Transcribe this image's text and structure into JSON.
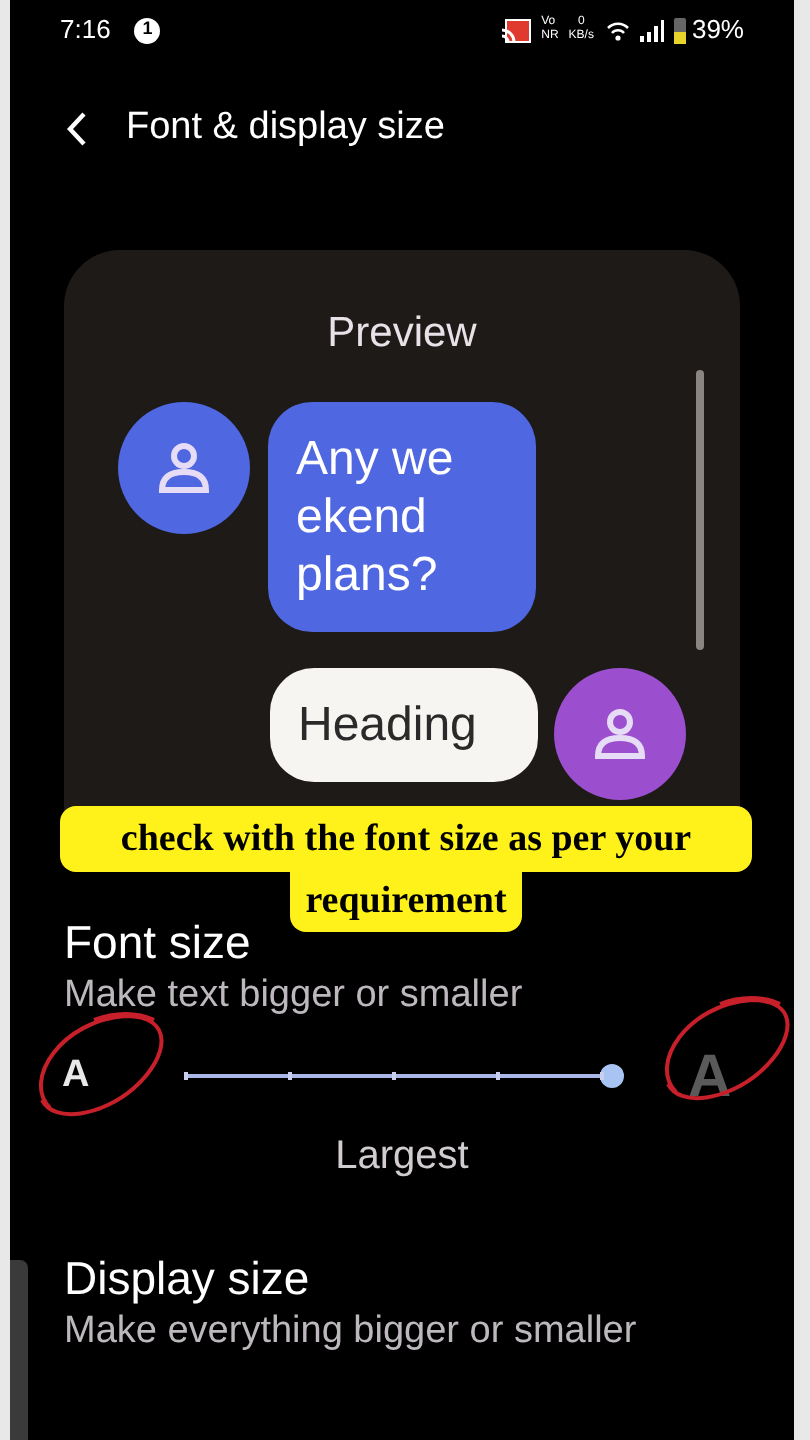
{
  "status_bar": {
    "time": "7:16",
    "notification_count": "1",
    "network_badge_top": "Vo",
    "network_badge_bottom": "NR",
    "speed_value": "0",
    "speed_unit": "KB/s",
    "battery": "39%"
  },
  "header": {
    "title": "Font & display size"
  },
  "preview": {
    "title": "Preview",
    "messages": [
      {
        "kind": "incoming",
        "text": "Any we ekend plans?",
        "color": "#4f67e0"
      },
      {
        "kind": "outgoing",
        "text": "Heading",
        "color": "#9b4fcf"
      }
    ]
  },
  "caption": {
    "line_1": "check with the font size as per your",
    "line_2": "requirement"
  },
  "font_size": {
    "title": "Font size",
    "subtitle": "Make text bigger or smaller",
    "small_label": "A",
    "large_label": "A",
    "level": 1,
    "value": "Largest"
  },
  "display_size": {
    "title": "Display size",
    "subtitle": "Make everything bigger or smaller"
  }
}
